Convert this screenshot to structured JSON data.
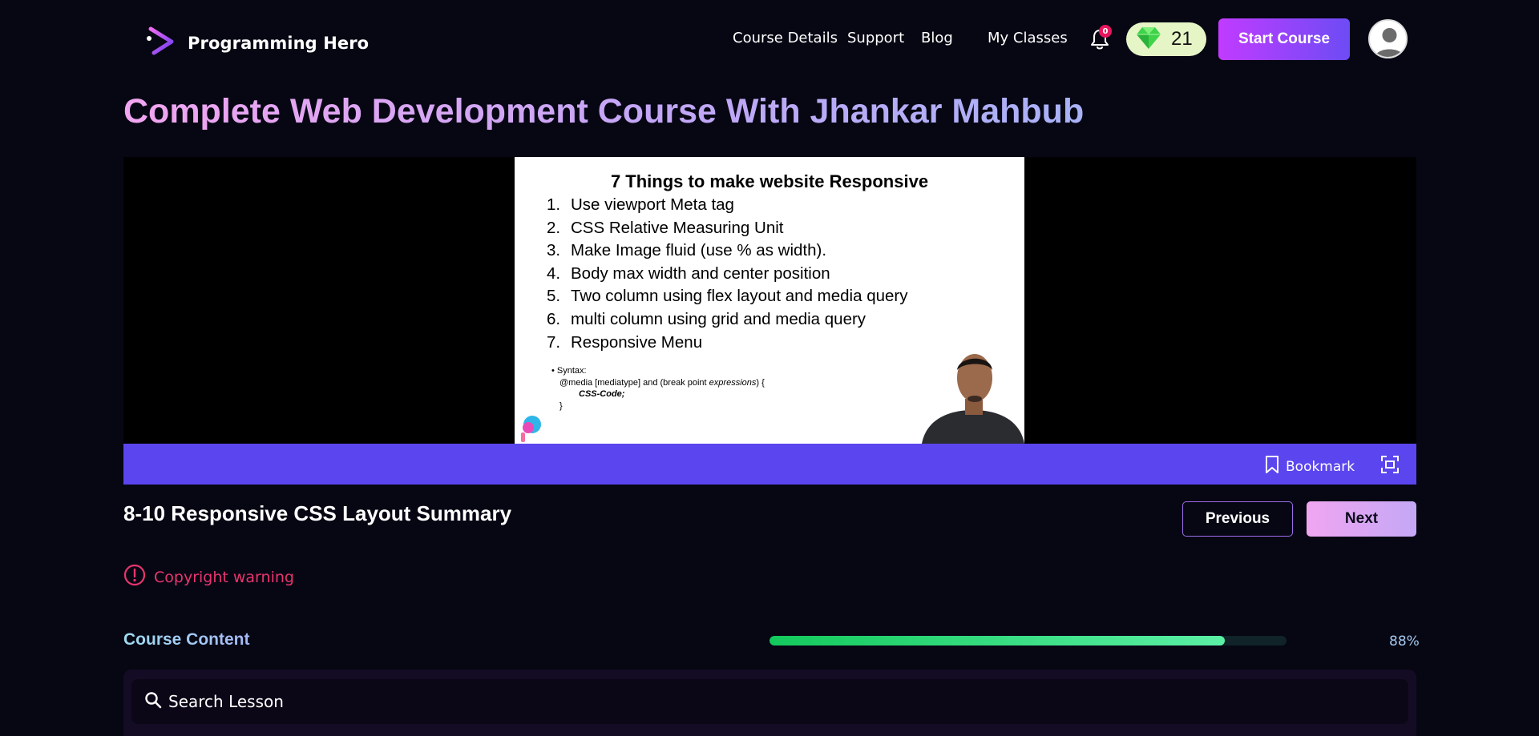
{
  "header": {
    "brand": "Programming Hero",
    "nav": [
      "Course Details",
      "Support",
      "Blog",
      "My Classes"
    ],
    "notification_count": "0",
    "gem_count": "21",
    "start_button": "Start Course"
  },
  "course": {
    "title": "Complete Web Development Course With Jhankar Mahbub"
  },
  "video": {
    "slide_title": "7 Things to make website Responsive",
    "slide_items": [
      {
        "num": "1.",
        "text": "Use viewport Meta tag"
      },
      {
        "num": "2.",
        "text": "CSS Relative Measuring Unit"
      },
      {
        "num": "3.",
        "text": "Make Image fluid (use % as width)."
      },
      {
        "num": "4.",
        "text": "Body max width and center position"
      },
      {
        "num": "5.",
        "text": "Two column using flex layout and media query"
      },
      {
        "num": "6.",
        "text": "multi column using grid and media query"
      },
      {
        "num": "7.",
        "text": "Responsive Menu"
      }
    ],
    "syntax_label": "Syntax:",
    "syntax_line1": "@media [mediatype] and (break point",
    "syntax_line1_em": "expressions",
    "syntax_line1_end": ") {",
    "syntax_line2": "CSS-Code;",
    "syntax_line3": "}",
    "bookmark_label": "Bookmark"
  },
  "lesson": {
    "title": "8-10 Responsive CSS Layout Summary",
    "previous_label": "Previous",
    "next_label": "Next",
    "copyright_warning": "Copyright warning"
  },
  "course_content": {
    "label": "Course Content",
    "progress": 88,
    "progress_label": "88%",
    "search_placeholder": "Search Lesson"
  },
  "colors": {
    "background": "#070714",
    "video_bar": "#5b45ee",
    "copyright": "#e8356d",
    "progress": "#13c95c"
  }
}
